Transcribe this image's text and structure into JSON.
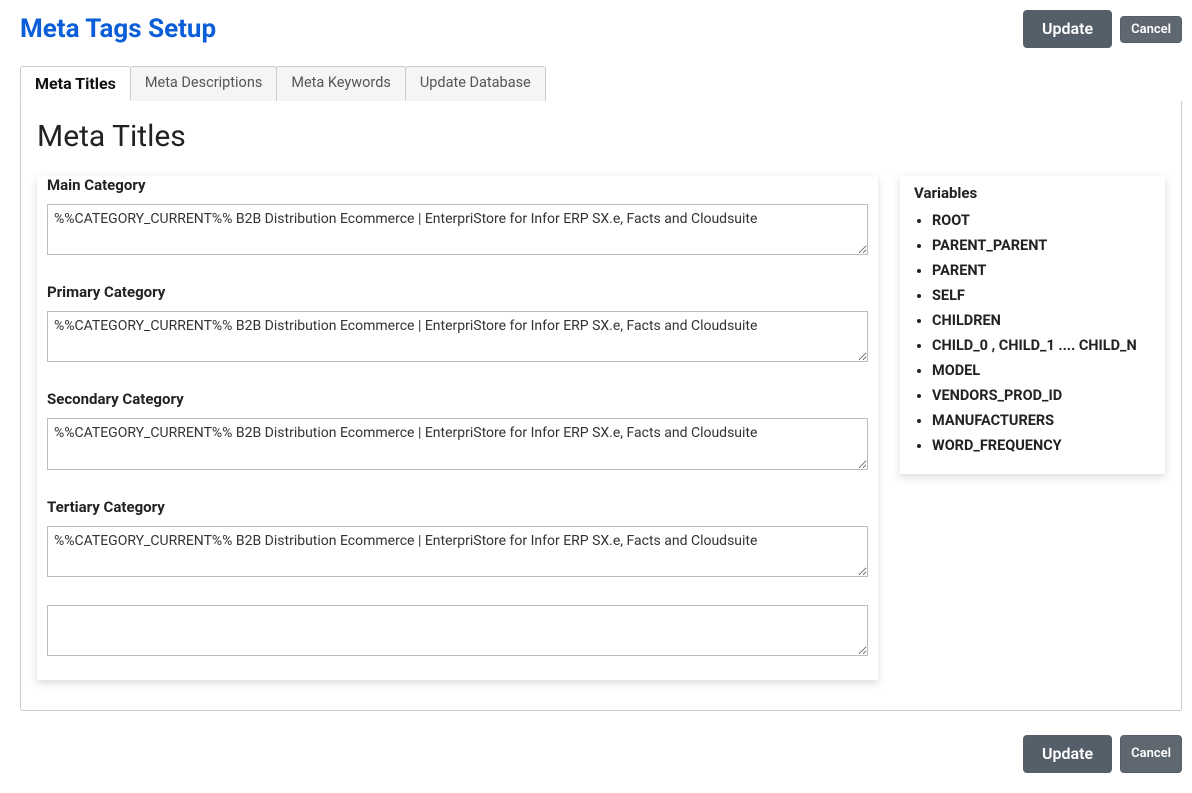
{
  "page": {
    "title": "Meta Tags Setup"
  },
  "buttons": {
    "update": "Update",
    "cancel": "Cancel"
  },
  "tabs": [
    {
      "label": "Meta Titles",
      "active": true
    },
    {
      "label": "Meta Descriptions",
      "active": false
    },
    {
      "label": "Meta Keywords",
      "active": false
    },
    {
      "label": "Update Database",
      "active": false
    }
  ],
  "section": {
    "title": "Meta Titles"
  },
  "fields": {
    "main_category": {
      "label": "Main Category",
      "value": "%%CATEGORY_CURRENT%% B2B Distribution Ecommerce | EnterpriStore for Infor ERP SX.e, Facts and Cloudsuite"
    },
    "primary_category": {
      "label": "Primary Category",
      "value": "%%CATEGORY_CURRENT%% B2B Distribution Ecommerce | EnterpriStore for Infor ERP SX.e, Facts and Cloudsuite"
    },
    "secondary_category": {
      "label": "Secondary Category",
      "value": "%%CATEGORY_CURRENT%% B2B Distribution Ecommerce | EnterpriStore for Infor ERP SX.e, Facts and Cloudsuite"
    },
    "tertiary_category": {
      "label": "Tertiary Category",
      "value": "%%CATEGORY_CURRENT%% B2B Distribution Ecommerce | EnterpriStore for Infor ERP SX.e, Facts and Cloudsuite"
    },
    "extra": {
      "value": ""
    }
  },
  "variables": {
    "title": "Variables",
    "items": [
      "ROOT",
      "PARENT_PARENT",
      "PARENT",
      "SELF",
      "CHILDREN",
      "CHILD_0 , CHILD_1 .... CHILD_N",
      "MODEL",
      "VENDORS_PROD_ID",
      "MANUFACTURERS",
      "WORD_FREQUENCY"
    ]
  }
}
